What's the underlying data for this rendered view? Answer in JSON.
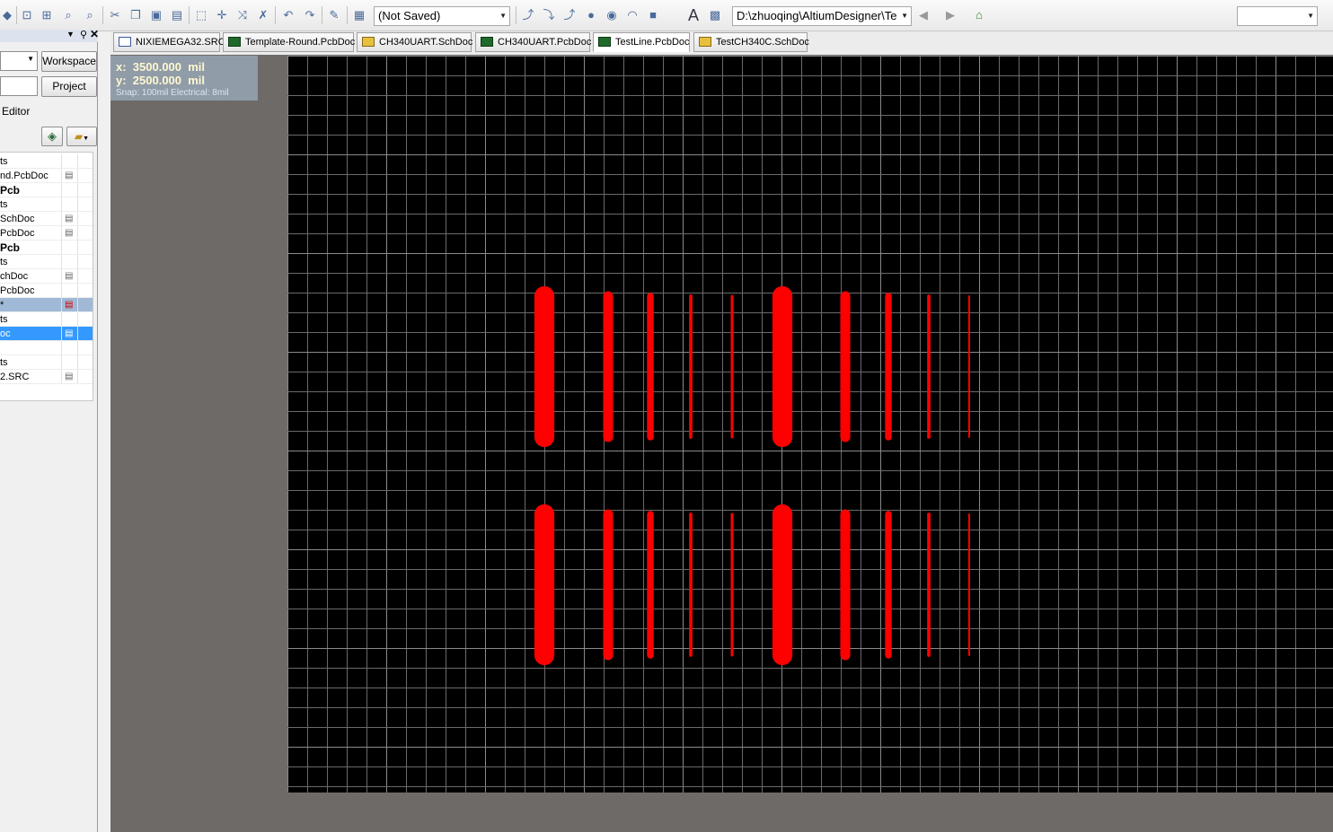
{
  "toolbar": {
    "view_combo": "(Not Saved)",
    "path_combo": "D:\\zhuoqing\\AltiumDesigner\\Te",
    "right_combo": ""
  },
  "side_panel": {
    "workspace_button": "Workspace",
    "project_button": "Project",
    "editor_label": "Editor",
    "tree_rows": [
      {
        "label": "ts",
        "doc_icon": false,
        "style": ""
      },
      {
        "label": "nd.PcbDoc",
        "doc_icon": true,
        "style": ""
      },
      {
        "label": "Pcb",
        "doc_icon": false,
        "style": "bold"
      },
      {
        "label": "ts",
        "doc_icon": false,
        "style": ""
      },
      {
        "label": "SchDoc",
        "doc_icon": true,
        "style": ""
      },
      {
        "label": "PcbDoc",
        "doc_icon": true,
        "style": ""
      },
      {
        "label": "Pcb",
        "doc_icon": false,
        "style": "bold"
      },
      {
        "label": "ts",
        "doc_icon": false,
        "style": ""
      },
      {
        "label": "chDoc",
        "doc_icon": true,
        "style": ""
      },
      {
        "label": "PcbDoc",
        "doc_icon": false,
        "style": ""
      },
      {
        "label": "*",
        "doc_icon": true,
        "style": "sel-grey"
      },
      {
        "label": "ts",
        "doc_icon": false,
        "style": ""
      },
      {
        "label": "oc",
        "doc_icon": true,
        "style": "sel-blue"
      },
      {
        "label": "",
        "doc_icon": false,
        "style": ""
      },
      {
        "label": "ts",
        "doc_icon": false,
        "style": ""
      },
      {
        "label": "2.SRC",
        "doc_icon": true,
        "style": ""
      }
    ]
  },
  "tabs": [
    {
      "label": "NIXIEMEGA32.SRC",
      "icon": "asm-file-icon",
      "active": false
    },
    {
      "label": "Template-Round.PcbDoc",
      "icon": "pcb-file-icon",
      "active": false
    },
    {
      "label": "CH340UART.SchDoc",
      "icon": "sch-file-icon",
      "active": false
    },
    {
      "label": "CH340UART.PcbDoc",
      "icon": "pcb-file-icon",
      "active": false
    },
    {
      "label": "TestLine.PcbDoc",
      "icon": "pcb-file-icon",
      "active": true
    },
    {
      "label": "TestCH340C.SchDoc",
      "icon": "sch-file-icon",
      "active": false
    }
  ],
  "hud": {
    "x": "x:  3500.000  mil",
    "y": "y:  2500.000  mil",
    "snap": "Snap: 100mil Electrical: 8mil"
  },
  "colors": {
    "board_background": "#000000",
    "grid_line": "#6a6a6a",
    "track": "#ff0000",
    "workspace": "#6e6a68"
  },
  "pcb": {
    "grid_pitch_mil": 100,
    "track_widths_mil": [
      60,
      30,
      20,
      10,
      8,
      60,
      30,
      20,
      10,
      5
    ]
  }
}
